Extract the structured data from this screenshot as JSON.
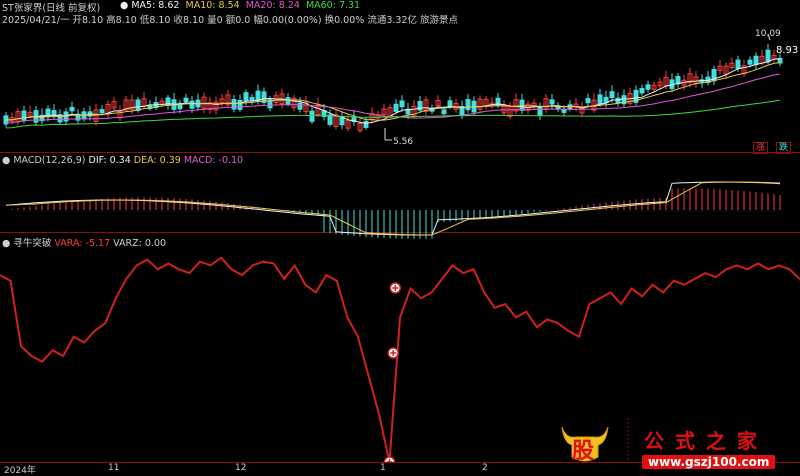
{
  "header": {
    "stock_name": "ST张家界(日线 前复权)",
    "ma_items": [
      {
        "label": "MA5: 8.62",
        "color": "#f0f0f0"
      },
      {
        "label": "MA10: 8.54",
        "color": "#e6c84d"
      },
      {
        "label": "MA20: 8.24",
        "color": "#e05bd8"
      },
      {
        "label": "MA60: 7.31",
        "color": "#40d840"
      }
    ],
    "info_line": "2025/04/21/一 开8.10 高8.10 低8.10 收8.10 量0 额0.0 幅0.00(0.00%) 换0.00% 流通3.32亿 旅游景点"
  },
  "price_panel": {
    "high_label": "10.09",
    "low_label": "5.56",
    "last_price_label": "8.93",
    "zhang_mark": "涨",
    "die_mark": "跌"
  },
  "macd_panel": {
    "title": "MACD(12,26,9)",
    "dif": "DIF: 0.34",
    "dea": "DEA: 0.39",
    "macd": "MACD: -0.10"
  },
  "indicator_panel": {
    "title": "寻牛突破",
    "vara": "VARA: -5.17",
    "varz": "VARZ: 0.00"
  },
  "x_axis": {
    "labels": [
      "2024年",
      "11",
      "12",
      "1",
      "2"
    ]
  },
  "watermark": {
    "logo_char": "股",
    "brand": "公 式 之 家",
    "url": "www.gszj100.com"
  },
  "colors": {
    "up": "#ff3a3a",
    "down": "#40e0e0",
    "separator": "#8a1010",
    "indicator_line": "#d02020"
  },
  "chart_data": {
    "type": "line",
    "vara_series": [
      -3,
      -6,
      -40,
      -45,
      -48,
      -42,
      -45,
      -35,
      -38,
      -32,
      -28,
      -15,
      -5,
      2,
      5,
      0,
      3,
      0,
      -2,
      4,
      2,
      6,
      0,
      -3,
      2,
      4,
      3,
      -5,
      2,
      -8,
      -12,
      -3,
      -6,
      -25,
      -35,
      -55,
      -75,
      -100,
      -25,
      -10,
      -15,
      -12,
      -5,
      2,
      -2,
      0,
      -12,
      -20,
      -18,
      -25,
      -22,
      -30,
      -26,
      -28,
      -32,
      -35,
      -18,
      -15,
      -12,
      -18,
      -10,
      -14,
      -8,
      -12,
      -6,
      -8,
      -5,
      -2,
      -4,
      0,
      2,
      0,
      3,
      0,
      2,
      0,
      -5.17
    ]
  }
}
